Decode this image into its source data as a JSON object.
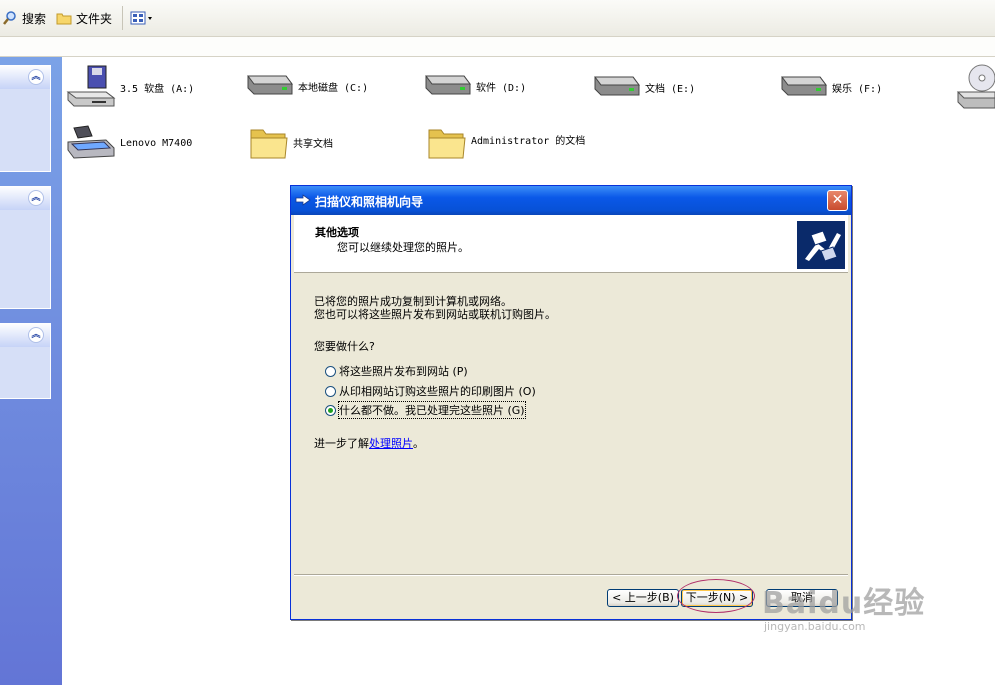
{
  "toolbar": {
    "search_label": "搜索",
    "folders_label": "文件夹",
    "views_icon": "views-grid-icon"
  },
  "task_pane": {
    "boxes": [
      {
        "collapse_glyph": "︽"
      },
      {
        "collapse_glyph": "︽"
      },
      {
        "collapse_glyph": "︽"
      }
    ]
  },
  "items": [
    {
      "label": "3.5 软盘 (A:)",
      "icon": "floppy-drive-icon"
    },
    {
      "label": "本地磁盘 (C:)",
      "icon": "hard-disk-icon"
    },
    {
      "label": "软件 (D:)",
      "icon": "hard-disk-icon"
    },
    {
      "label": "文档 (E:)",
      "icon": "hard-disk-icon"
    },
    {
      "label": "娱乐 (F:)",
      "icon": "hard-disk-icon"
    },
    {
      "label": "",
      "icon": "cd-drive-icon"
    },
    {
      "label": "Lenovo M7400",
      "icon": "scanner-icon"
    },
    {
      "label": "共享文档",
      "icon": "folder-icon"
    },
    {
      "label": "Administrator 的文档",
      "icon": "folder-icon"
    }
  ],
  "dialog": {
    "title": "扫描仪和照相机向导",
    "close_glyph": "✕",
    "header_title": "其他选项",
    "header_subtitle": "您可以继续处理您的照片。",
    "intro_line1": "已将您的照片成功复制到计算机或网络。",
    "intro_line2": "您也可以将这些照片发布到网站或联机订购图片。",
    "question": "您要做什么?",
    "options": [
      {
        "label": "将这些照片发布到网站 (P)",
        "checked": false
      },
      {
        "label": "从印相网站订购这些照片的印刷图片 (O)",
        "checked": false
      },
      {
        "label": "什么都不做。我已处理完这些照片 (G)",
        "checked": true
      }
    ],
    "learn_more_prefix": "进一步了解",
    "learn_more_link": "处理照片",
    "learn_more_suffix": "。",
    "buttons": {
      "back": "< 上一步(B)",
      "next": "下一步(N) >",
      "cancel": "取消"
    }
  },
  "watermark": {
    "brand": "Baidu经验",
    "url": "jingyan.baidu.com"
  }
}
